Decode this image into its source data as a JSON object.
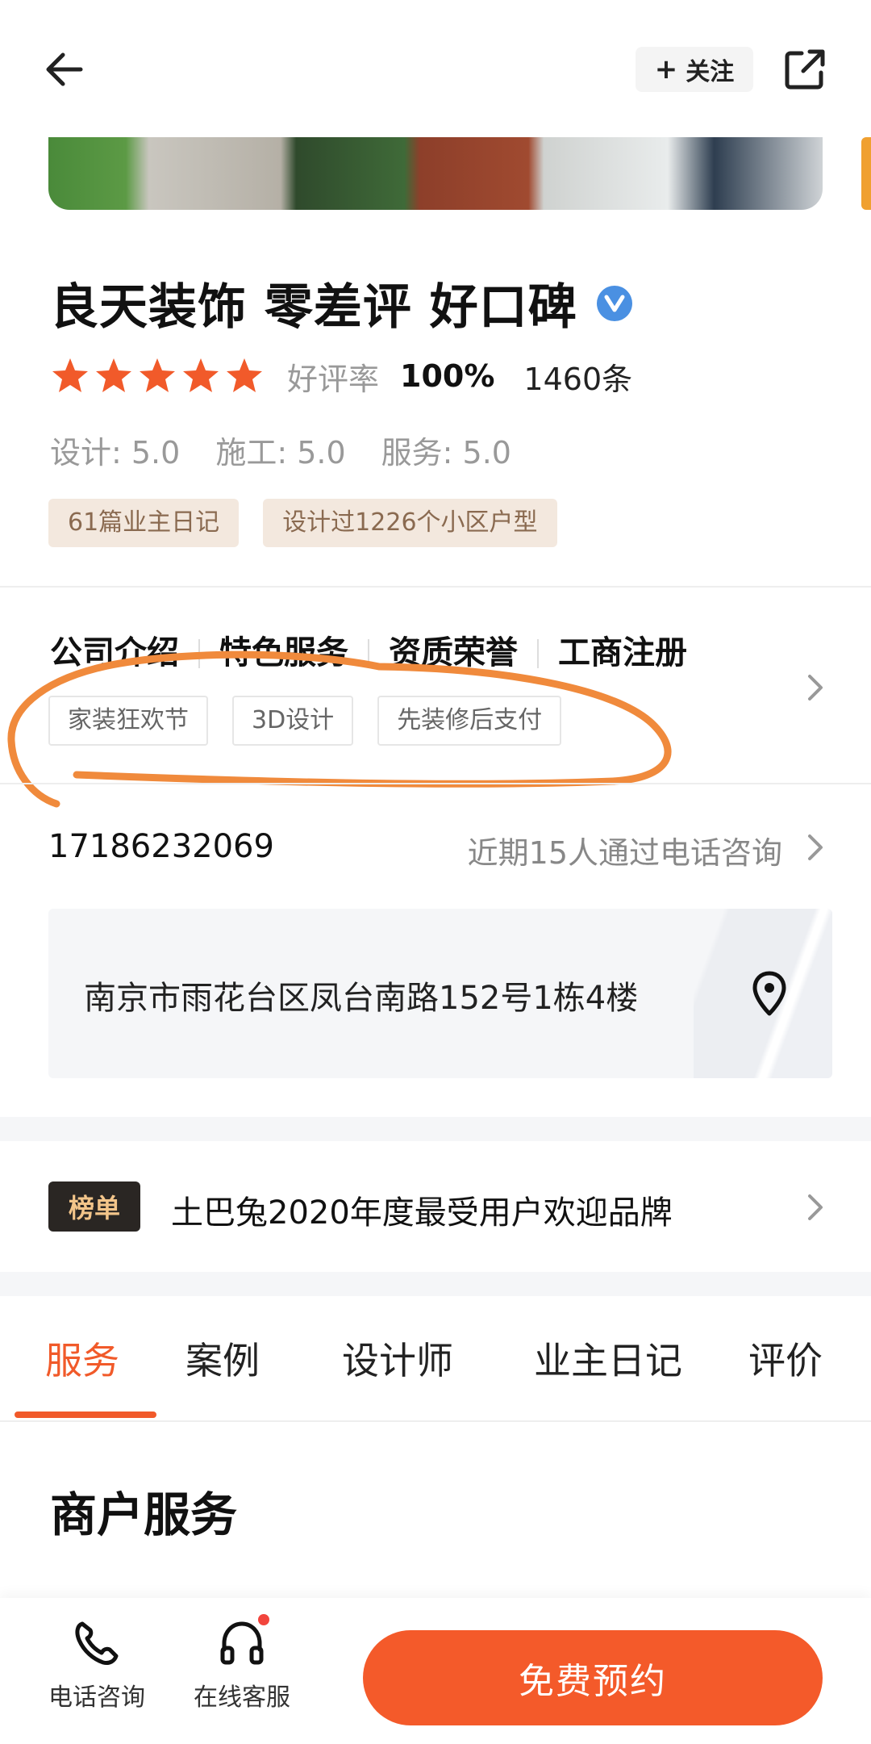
{
  "header": {
    "follow_label": "关注",
    "follow_icon": "plus-icon",
    "back_icon": "back-arrow-icon",
    "share_icon": "share-icon"
  },
  "company": {
    "name": "良天装饰 零差评 好口碑",
    "verified_icon": "verified-badge-icon",
    "rating_stars": 5,
    "rating_max": 5,
    "positive_rate_label": "好评率",
    "positive_rate_value": "100%",
    "review_count": "1460条",
    "scores": [
      {
        "text": "设计: 5.0"
      },
      {
        "text": "施工: 5.0"
      },
      {
        "text": "服务: 5.0"
      }
    ],
    "tags": [
      {
        "label": "61篇业主日记"
      },
      {
        "label": "设计过1226个小区户型"
      }
    ]
  },
  "info": {
    "tabs": [
      {
        "label": "公司介绍"
      },
      {
        "label": "特色服务"
      },
      {
        "label": "资质荣誉"
      },
      {
        "label": "工商注册"
      }
    ],
    "service_tags": [
      {
        "label": "家装狂欢节"
      },
      {
        "label": "3D设计"
      },
      {
        "label": "先装修后支付"
      }
    ]
  },
  "contact": {
    "phone": "17186232069",
    "consult_text": "近期15人通过电话咨询",
    "address": "南京市雨花台区凤台南路152号1栋4楼"
  },
  "ranking": {
    "badge": "榜单",
    "text": "土巴兔2020年度最受用户欢迎品牌"
  },
  "section_tabs": [
    {
      "label": "服务",
      "active": true
    },
    {
      "label": "案例",
      "active": false
    },
    {
      "label": "设计师",
      "active": false
    },
    {
      "label": "业主日记",
      "active": false
    },
    {
      "label": "评价",
      "active": false
    }
  ],
  "section": {
    "title": "商户服务"
  },
  "bottom_bar": {
    "phone_label": "电话咨询",
    "phone_icon": "phone-icon",
    "service_label": "在线客服",
    "service_icon": "headset-icon",
    "reserve_label": "免费预约"
  },
  "colors": {
    "accent": "#f15a2a",
    "star": "#f15a2a",
    "verified": "#4a90e2",
    "annotation": "#f08a3c"
  }
}
